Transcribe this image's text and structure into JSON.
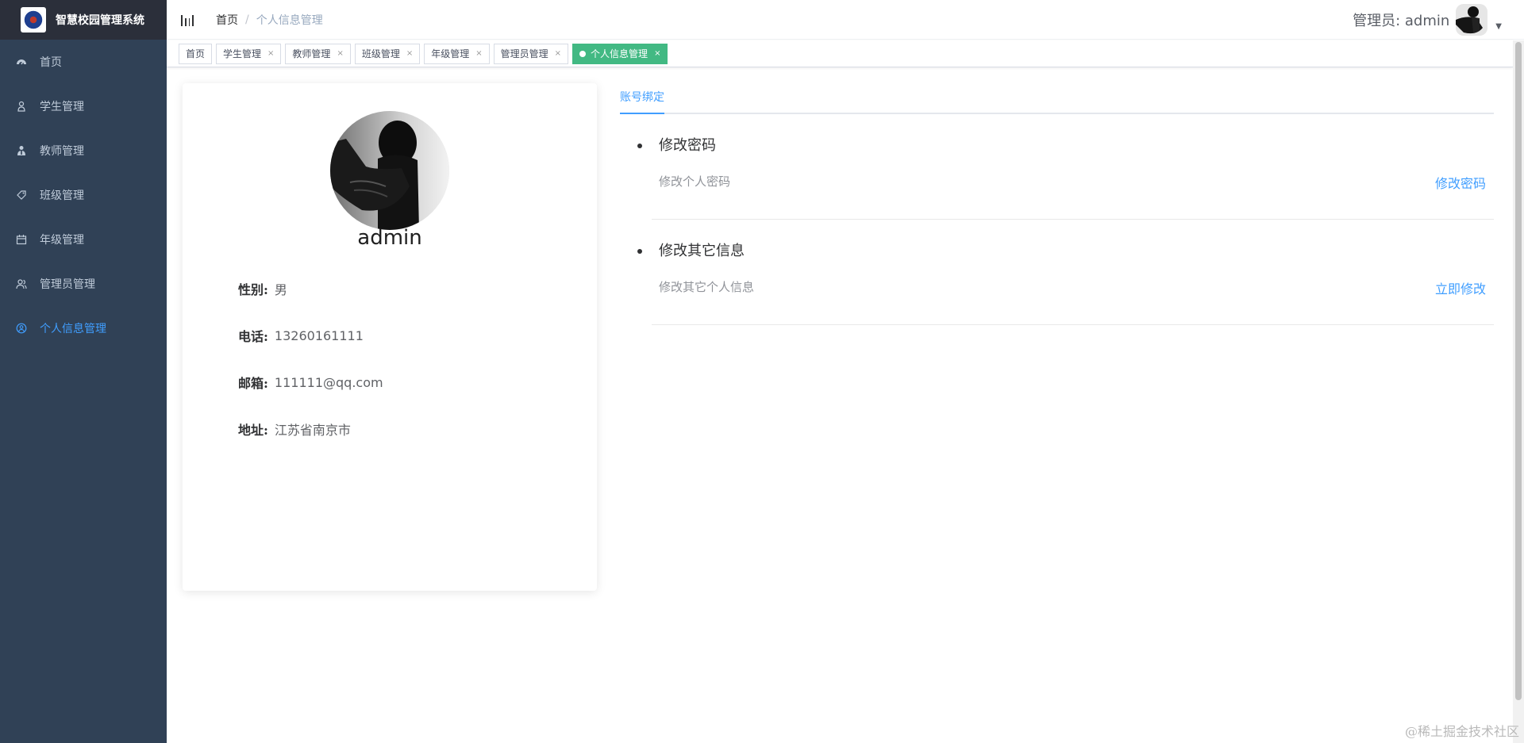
{
  "app": {
    "title": "智慧校园管理系统"
  },
  "sidebar": {
    "items": [
      {
        "label": "首页",
        "icon": "dashboard-icon",
        "active": false
      },
      {
        "label": "学生管理",
        "icon": "user-icon",
        "active": false
      },
      {
        "label": "教师管理",
        "icon": "teacher-icon",
        "active": false
      },
      {
        "label": "班级管理",
        "icon": "tag-icon",
        "active": false
      },
      {
        "label": "年级管理",
        "icon": "calendar-icon",
        "active": false
      },
      {
        "label": "管理员管理",
        "icon": "admin-icon",
        "active": false
      },
      {
        "label": "个人信息管理",
        "icon": "profile-icon",
        "active": true
      }
    ]
  },
  "breadcrumb": {
    "home": "首页",
    "separator": "/",
    "current": "个人信息管理"
  },
  "user": {
    "label": "管理员: admin"
  },
  "tags": [
    {
      "label": "首页",
      "closable": false,
      "active": false
    },
    {
      "label": "学生管理",
      "closable": true,
      "active": false
    },
    {
      "label": "教师管理",
      "closable": true,
      "active": false
    },
    {
      "label": "班级管理",
      "closable": true,
      "active": false
    },
    {
      "label": "年级管理",
      "closable": true,
      "active": false
    },
    {
      "label": "管理员管理",
      "closable": true,
      "active": false
    },
    {
      "label": "个人信息管理",
      "closable": true,
      "active": true
    }
  ],
  "profile": {
    "name": "admin",
    "fields": [
      {
        "label": "性别:",
        "value": "男"
      },
      {
        "label": "电话:",
        "value": "13260161111"
      },
      {
        "label": "邮箱:",
        "value": "111111@qq.com"
      },
      {
        "label": "地址:",
        "value": "江苏省南京市"
      }
    ]
  },
  "account": {
    "tab_label": "账号绑定",
    "items": [
      {
        "title": "修改密码",
        "desc": "修改个人密码",
        "action": "修改密码"
      },
      {
        "title": "修改其它信息",
        "desc": "修改其它个人信息",
        "action": "立即修改"
      }
    ]
  },
  "watermark": "@稀土掘金技术社区",
  "colors": {
    "sidebar_bg": "#304156",
    "accent": "#409eff",
    "active_tag": "#42b983"
  }
}
